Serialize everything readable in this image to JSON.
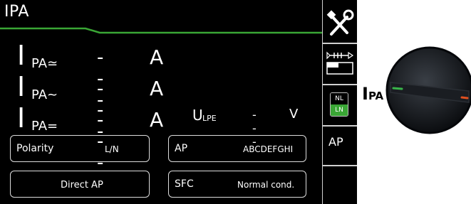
{
  "screen": {
    "title": "IPA",
    "measurements": [
      {
        "symbol": "I",
        "subscript": "PA≃",
        "value": "- - -",
        "unit": "A"
      },
      {
        "symbol": "I",
        "subscript": "PA~",
        "value": "- - -",
        "unit": "A"
      },
      {
        "symbol": "I",
        "subscript": "PA=",
        "value": "- - -",
        "unit": "A"
      }
    ],
    "ulpe": {
      "symbol": "U",
      "subscript": "LPE",
      "value": "- - -",
      "unit": "V"
    },
    "fields": {
      "polarity": {
        "label": "Polarity",
        "value": "L/N"
      },
      "ap": {
        "label": "AP",
        "value": "ABCDEFGHI"
      },
      "direct_ap": {
        "value": "Direct AP"
      },
      "sfc": {
        "label": "SFC",
        "value": "Normal cond."
      }
    }
  },
  "sidebar": {
    "settings_icon": "tools-icon",
    "probe_icon": "probe-icon",
    "nl_label": "NL",
    "ln_label": "LN",
    "ap_label": "AP"
  },
  "rotary_switch": {
    "label_main": "I",
    "label_sub": "PA"
  },
  "colors": {
    "screen_bg": "#000000",
    "accent_green": "#3aa635",
    "knob_indicator_green": "#39b54a",
    "knob_indicator_red": "#e05020"
  }
}
